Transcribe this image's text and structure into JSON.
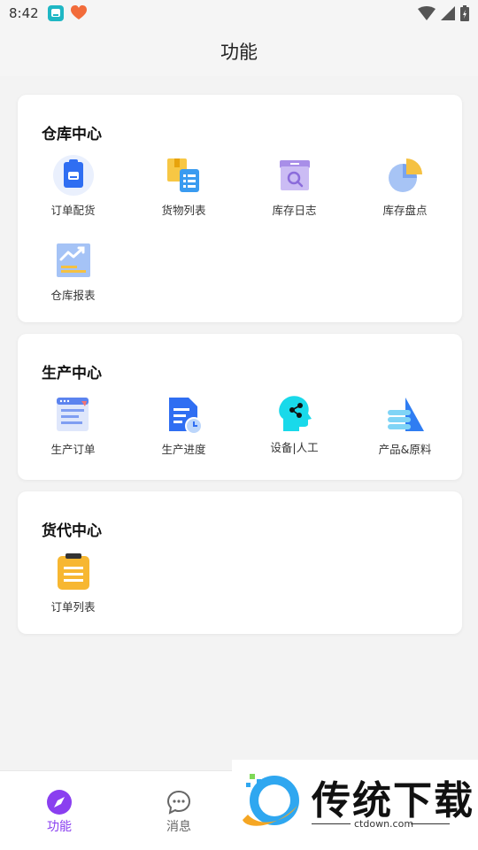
{
  "status_bar": {
    "time": "8:42"
  },
  "header": {
    "title": "功能"
  },
  "sections": [
    {
      "title": "仓库中心",
      "items": [
        "订单配货",
        "货物列表",
        "库存日志",
        "库存盘点",
        "仓库报表"
      ]
    },
    {
      "title": "生产中心",
      "items": [
        "生产订单",
        "生产进度",
        "设备|人工",
        "产品&原料"
      ]
    },
    {
      "title": "货代中心",
      "items": [
        "订单列表"
      ]
    }
  ],
  "tabbar": {
    "tab1": "功能",
    "tab2": "消息"
  },
  "watermark": {
    "brand": "传统下载",
    "url": "ctdown.com"
  },
  "colors": {
    "accent": "#8a3ff0",
    "tab_inactive": "#666666",
    "icon_blue": "#2f6ef2"
  }
}
